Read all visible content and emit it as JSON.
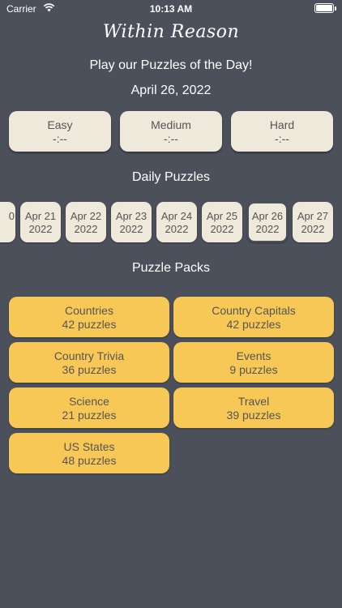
{
  "status_bar": {
    "carrier": "Carrier",
    "time": "10:13 AM"
  },
  "app_title": "Within Reason",
  "subtitle": "Play our Puzzles of the Day!",
  "date": "April 26, 2022",
  "difficulty": [
    {
      "label": "Easy",
      "time": "-:--"
    },
    {
      "label": "Medium",
      "time": "-:--"
    },
    {
      "label": "Hard",
      "time": "-:--"
    }
  ],
  "daily_heading": "Daily Puzzles",
  "daily": [
    {
      "month_day": "0",
      "year": ""
    },
    {
      "month_day": "Apr 21",
      "year": "2022"
    },
    {
      "month_day": "Apr 22",
      "year": "2022"
    },
    {
      "month_day": "Apr 23",
      "year": "2022"
    },
    {
      "month_day": "Apr 24",
      "year": "2022"
    },
    {
      "month_day": "Apr 25",
      "year": "2022"
    },
    {
      "month_day": "Apr 26",
      "year": "2022"
    },
    {
      "month_day": "Apr 27",
      "year": "2022"
    }
  ],
  "packs_heading": "Puzzle Packs",
  "packs": [
    {
      "name": "Countries",
      "count": "42 puzzles"
    },
    {
      "name": "Country Capitals",
      "count": "42 puzzles"
    },
    {
      "name": "Country Trivia",
      "count": "36 puzzles"
    },
    {
      "name": "Events",
      "count": "9 puzzles"
    },
    {
      "name": "Science",
      "count": "21 puzzles"
    },
    {
      "name": "Travel",
      "count": "39 puzzles"
    },
    {
      "name": "US States",
      "count": "48 puzzles"
    }
  ],
  "colors": {
    "background": "#4b505b",
    "tile": "#efe9dc",
    "pack": "#f8c857"
  }
}
